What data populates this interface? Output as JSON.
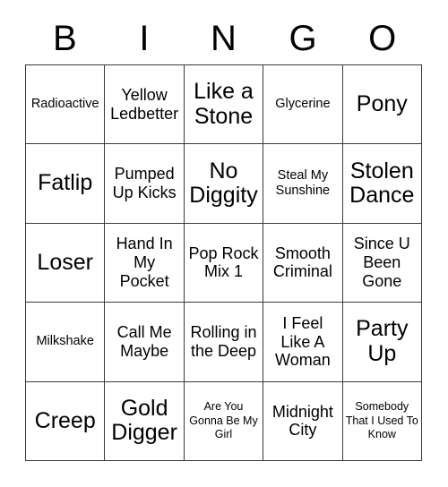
{
  "header": {
    "letters": [
      "B",
      "I",
      "N",
      "G",
      "O"
    ]
  },
  "grid": {
    "columns": 5,
    "rows": 5,
    "border_color": "#3a3a3a",
    "cell_background": "#ffffff",
    "text_color": "#000000"
  },
  "cells": [
    {
      "text": "Radioactive",
      "size": "sm"
    },
    {
      "text": "Yellow Ledbetter",
      "size": "md"
    },
    {
      "text": "Like a Stone",
      "size": "xl"
    },
    {
      "text": "Glycerine",
      "size": "sm"
    },
    {
      "text": "Pony",
      "size": "xl"
    },
    {
      "text": "Fatlip",
      "size": "xl"
    },
    {
      "text": "Pumped Up Kicks",
      "size": "md"
    },
    {
      "text": "No Diggity",
      "size": "xl"
    },
    {
      "text": "Steal My Sunshine",
      "size": "sm"
    },
    {
      "text": "Stolen Dance",
      "size": "xl"
    },
    {
      "text": "Loser",
      "size": "xl"
    },
    {
      "text": "Hand In My Pocket",
      "size": "md"
    },
    {
      "text": "Pop Rock Mix 1",
      "size": "md"
    },
    {
      "text": "Smooth Criminal",
      "size": "md"
    },
    {
      "text": "Since U Been Gone",
      "size": "md"
    },
    {
      "text": "Milkshake",
      "size": "sm"
    },
    {
      "text": "Call Me Maybe",
      "size": "md"
    },
    {
      "text": "Rolling in the Deep",
      "size": "md"
    },
    {
      "text": "I Feel Like A Woman",
      "size": "md"
    },
    {
      "text": "Party Up",
      "size": "xl"
    },
    {
      "text": "Creep",
      "size": "xl"
    },
    {
      "text": "Gold Digger",
      "size": "xl"
    },
    {
      "text": "Are You Gonna Be My Girl",
      "size": "xs"
    },
    {
      "text": "Midnight City",
      "size": "md"
    },
    {
      "text": "Somebody That I Used To Know",
      "size": "xs"
    }
  ]
}
